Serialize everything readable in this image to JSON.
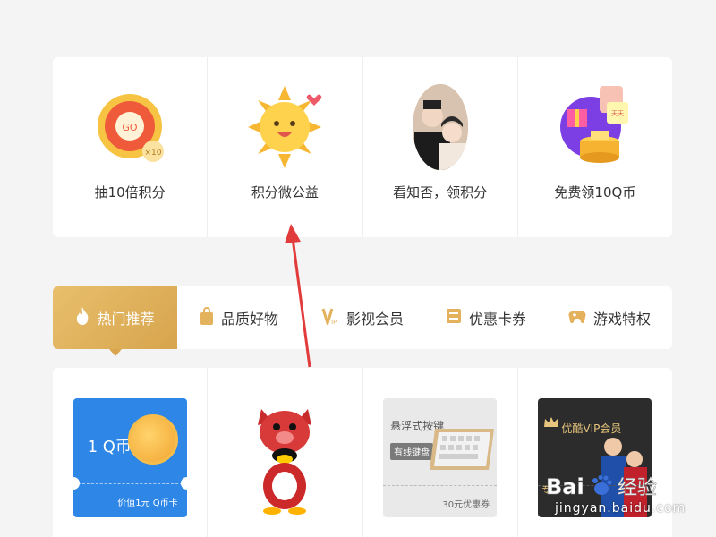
{
  "top_items": [
    {
      "label": "抽10倍积分",
      "icon": "lottery-wheel-icon"
    },
    {
      "label": "积分微公益",
      "icon": "sun-mascot-icon"
    },
    {
      "label": "看知否，领积分",
      "icon": "drama-couple-icon"
    },
    {
      "label": "免费领10Q币",
      "icon": "gift-box-icon"
    }
  ],
  "tabs": [
    {
      "label": "热门推荐",
      "icon": "flame-icon",
      "active": true
    },
    {
      "label": "品质好物",
      "icon": "shopping-bag-icon"
    },
    {
      "label": "影视会员",
      "icon": "vip-icon"
    },
    {
      "label": "优惠卡券",
      "icon": "coupon-icon"
    },
    {
      "label": "游戏特权",
      "icon": "gamepad-icon"
    }
  ],
  "products": {
    "qcoin": {
      "title": "1 Q币",
      "footer": "价值1元 Q币卡"
    },
    "keyboard": {
      "title": "悬浮式按键",
      "tag": "有线键盘",
      "footer": "30元优惠券"
    },
    "vip": {
      "title": "优酷VIP会员",
      "footer": "专"
    }
  },
  "watermark": {
    "brand": "Bai",
    "brand2": "经验",
    "url": "jingyan.baidu.com"
  },
  "colors": {
    "accent_gold": "#d9a64f",
    "qcoin_blue": "#2e86e6",
    "arrow_red": "#e23b3b"
  }
}
